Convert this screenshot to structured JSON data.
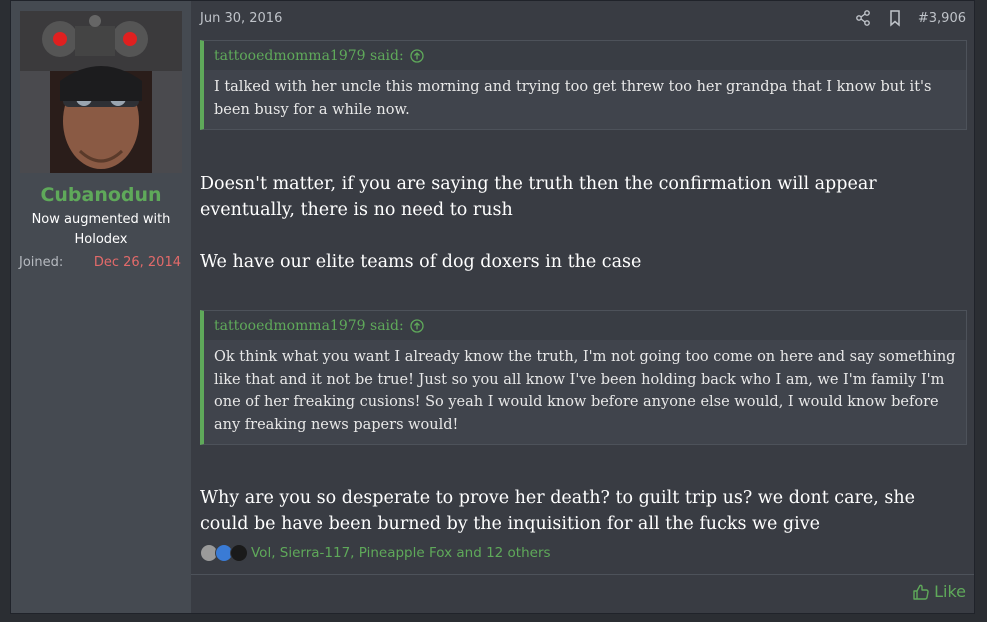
{
  "user": {
    "name": "Cubanodun",
    "title": "Now augmented with Holodex",
    "joined_label": "Joined:",
    "joined_date": "Dec 26, 2014"
  },
  "post": {
    "date": "Jun 30, 2016",
    "number": "#3,906",
    "quotes": [
      {
        "author": "tattooedmomma1979 said:",
        "text": "I talked with her uncle this morning and trying too get threw too her grandpa that I know but it's been busy for a while now."
      },
      {
        "author": "tattooedmomma1979 said:",
        "text": "Ok think what you want I already know the truth, I'm not going too come on here and say something like that and it not be true! Just so you all know I've been holding back who I am, we I'm family I'm one of her freaking cusions! So yeah I would know before anyone else would, I would know before any freaking news papers would!"
      }
    ],
    "paragraphs": [
      "Doesn't matter, if you are saying the truth then the confirmation will appear eventually, there is no need to rush",
      "We have our elite teams of dog doxers in the case",
      "Why are you so desperate to prove her death? to guilt trip us? we dont care, she could be have been burned by the inquisition for all the fucks we give"
    ],
    "reactions_text": "Vol, Sierra-117, Pineapple Fox and 12 others",
    "like_label": "Like"
  },
  "icons": [
    "share-icon",
    "bookmark-icon",
    "quote-arrow-up-icon",
    "thumbs-up-icon"
  ],
  "colors": {
    "accent": "#5fa95a",
    "joined_date": "#e36a6a",
    "post_bg": "#393c43",
    "sidebar_bg": "#454a51"
  }
}
